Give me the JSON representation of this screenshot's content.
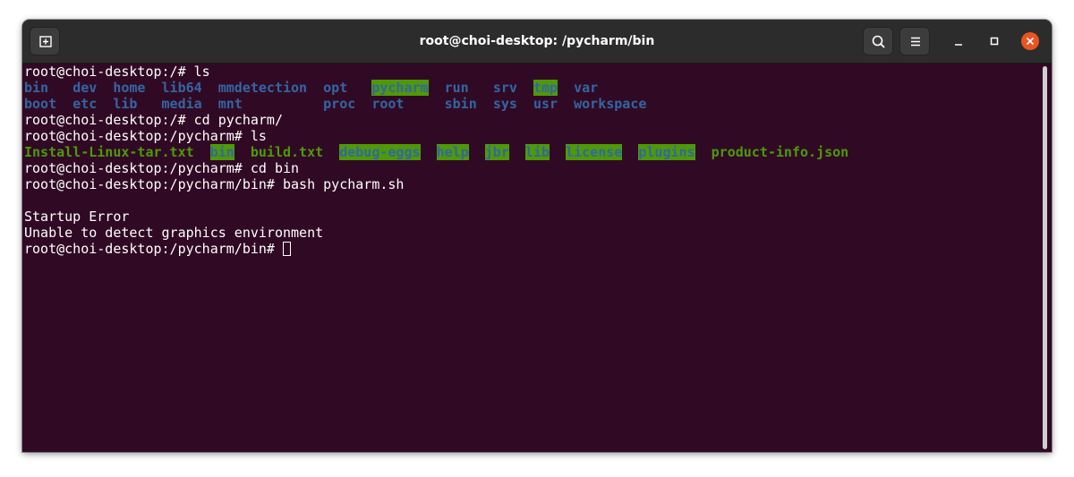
{
  "window": {
    "title": "root@choi-desktop: /pycharm/bin"
  },
  "toolbar": {
    "new_tab_icon": "new-tab-icon",
    "search_icon": "search-icon",
    "menu_icon": "hamburger-menu-icon",
    "minimize_icon": "minimize-icon",
    "maximize_icon": "maximize-icon",
    "close_icon": "close-icon"
  },
  "colors": {
    "terminal_bg": "#300a24",
    "titlebar_bg": "#2c2c2c",
    "dir_blue": "#3465a4",
    "exec_green": "#4e9a06",
    "close_orange": "#e95420"
  },
  "terminal": {
    "lines": [
      [
        {
          "t": "root@choi-desktop:/# ls",
          "c": ""
        }
      ],
      [
        {
          "t": "bin",
          "c": "dir"
        },
        {
          "t": "   ",
          "c": ""
        },
        {
          "t": "dev",
          "c": "dir"
        },
        {
          "t": "  ",
          "c": ""
        },
        {
          "t": "home",
          "c": "dir"
        },
        {
          "t": "  ",
          "c": ""
        },
        {
          "t": "lib64",
          "c": "dir"
        },
        {
          "t": "  ",
          "c": ""
        },
        {
          "t": "mmdetection",
          "c": "dir"
        },
        {
          "t": "  ",
          "c": ""
        },
        {
          "t": "opt",
          "c": "dir"
        },
        {
          "t": "   ",
          "c": ""
        },
        {
          "t": "pycharm",
          "c": "hl"
        },
        {
          "t": "  ",
          "c": ""
        },
        {
          "t": "run",
          "c": "dir"
        },
        {
          "t": "   ",
          "c": ""
        },
        {
          "t": "srv",
          "c": "dir"
        },
        {
          "t": "  ",
          "c": ""
        },
        {
          "t": "tmp",
          "c": "hl"
        },
        {
          "t": "  ",
          "c": ""
        },
        {
          "t": "var",
          "c": "dir"
        }
      ],
      [
        {
          "t": "boot",
          "c": "dir"
        },
        {
          "t": "  ",
          "c": ""
        },
        {
          "t": "etc",
          "c": "dir"
        },
        {
          "t": "  ",
          "c": ""
        },
        {
          "t": "lib",
          "c": "dir"
        },
        {
          "t": "   ",
          "c": ""
        },
        {
          "t": "media",
          "c": "dir"
        },
        {
          "t": "  ",
          "c": ""
        },
        {
          "t": "mnt",
          "c": "dir"
        },
        {
          "t": "          ",
          "c": ""
        },
        {
          "t": "proc",
          "c": "dir"
        },
        {
          "t": "  ",
          "c": ""
        },
        {
          "t": "root",
          "c": "dir"
        },
        {
          "t": "     ",
          "c": ""
        },
        {
          "t": "sbin",
          "c": "dir"
        },
        {
          "t": "  ",
          "c": ""
        },
        {
          "t": "sys",
          "c": "dir"
        },
        {
          "t": "  ",
          "c": ""
        },
        {
          "t": "usr",
          "c": "dir"
        },
        {
          "t": "  ",
          "c": ""
        },
        {
          "t": "workspace",
          "c": "dir"
        }
      ],
      [
        {
          "t": "root@choi-desktop:/# cd pycharm/",
          "c": ""
        }
      ],
      [
        {
          "t": "root@choi-desktop:/pycharm# ls",
          "c": ""
        }
      ],
      [
        {
          "t": "Install-Linux-tar.txt",
          "c": "exe"
        },
        {
          "t": "  ",
          "c": ""
        },
        {
          "t": "bin",
          "c": "hl"
        },
        {
          "t": "  ",
          "c": ""
        },
        {
          "t": "build.txt",
          "c": "exe"
        },
        {
          "t": "  ",
          "c": ""
        },
        {
          "t": "debug-eggs",
          "c": "hl"
        },
        {
          "t": "  ",
          "c": ""
        },
        {
          "t": "help",
          "c": "hl"
        },
        {
          "t": "  ",
          "c": ""
        },
        {
          "t": "jbr",
          "c": "hl"
        },
        {
          "t": "  ",
          "c": ""
        },
        {
          "t": "lib",
          "c": "hl"
        },
        {
          "t": "  ",
          "c": ""
        },
        {
          "t": "license",
          "c": "hl"
        },
        {
          "t": "  ",
          "c": ""
        },
        {
          "t": "plugins",
          "c": "hl"
        },
        {
          "t": "  ",
          "c": ""
        },
        {
          "t": "product-info.json",
          "c": "exe"
        }
      ],
      [
        {
          "t": "root@choi-desktop:/pycharm# cd bin",
          "c": ""
        }
      ],
      [
        {
          "t": "root@choi-desktop:/pycharm/bin# bash pycharm.sh",
          "c": ""
        }
      ],
      [
        {
          "t": "",
          "c": ""
        }
      ],
      [
        {
          "t": "Startup Error",
          "c": ""
        }
      ],
      [
        {
          "t": "Unable to detect graphics environment",
          "c": ""
        }
      ],
      [
        {
          "t": "root@choi-desktop:/pycharm/bin# ",
          "c": ""
        }
      ]
    ]
  }
}
